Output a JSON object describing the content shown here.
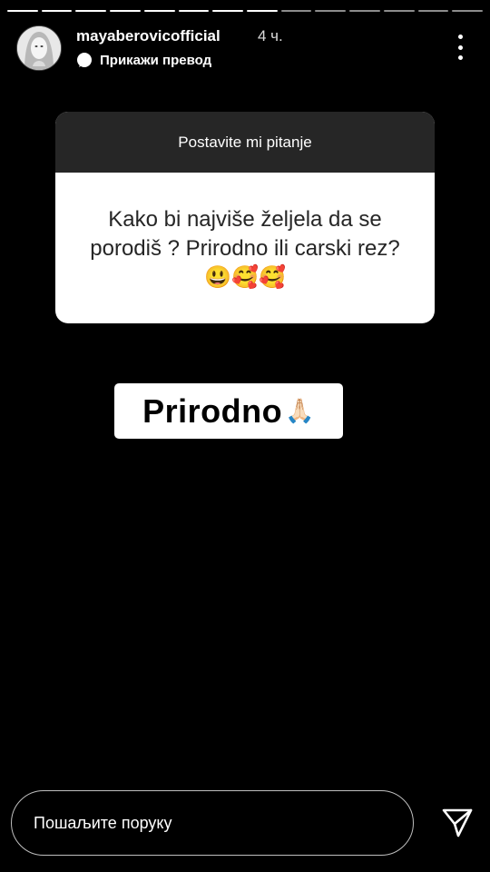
{
  "header": {
    "username": "mayaberovicofficial",
    "time": "4 ч.",
    "translate_label": "Прикажи превод"
  },
  "question": {
    "title": "Postavite mi pitanje",
    "text": "Kako bi najviše željela da se porodiš ? Prirodno ili carski rez? 😃🥰🥰"
  },
  "answer": {
    "text": "Prirodno",
    "emoji": "🙏🏻"
  },
  "footer": {
    "message_placeholder": "Пошаљите поруку"
  },
  "progress": {
    "total_segments": 14,
    "completed_segments": 8
  }
}
